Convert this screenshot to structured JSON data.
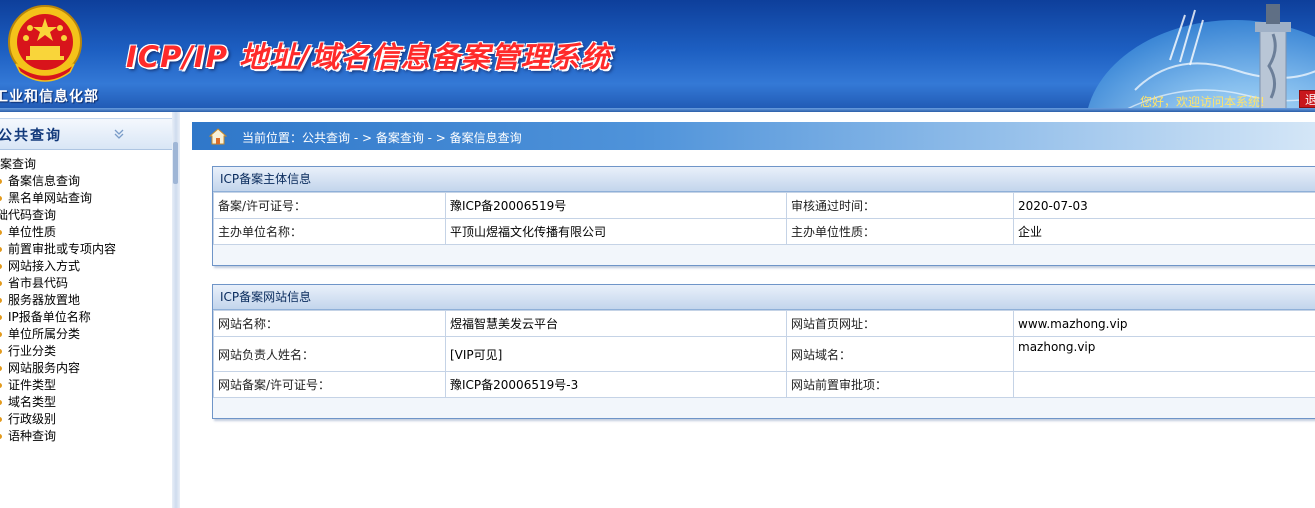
{
  "header": {
    "ministry": "工业和信息化部",
    "title": "ICP/IP 地址/域名信息备案管理系统",
    "welcome": "您好，欢迎访问本系统!",
    "logout": "退"
  },
  "sidebar": {
    "title": "公共查询",
    "groups": [
      {
        "label": "备案查询",
        "items": [
          "备案信息查询",
          "黑名单网站查询"
        ]
      },
      {
        "label": "基础代码查询",
        "items": [
          "单位性质",
          "前置审批或专项内容",
          "网站接入方式",
          "省市县代码",
          "服务器放置地",
          "IP报备单位名称",
          "单位所属分类",
          "行业分类",
          "网站服务内容",
          "证件类型",
          "域名类型",
          "行政级别",
          "语种查询"
        ]
      }
    ]
  },
  "breadcrumb": "当前位置：公共查询 - > 备案查询 - > 备案信息查询",
  "subject": {
    "heading": "ICP备案主体信息",
    "rows": [
      [
        "备案/许可证号：",
        "豫ICP备20006519号",
        "审核通过时间：",
        "2020-07-03"
      ],
      [
        "主办单位名称：",
        "平顶山煜福文化传播有限公司",
        "主办单位性质：",
        "企业"
      ]
    ]
  },
  "website": {
    "heading": "ICP备案网站信息",
    "rows": [
      [
        "网站名称：",
        "煜福智慧美发云平台",
        "网站首页网址：",
        "www.mazhong.vip"
      ],
      [
        "网站负责人姓名：",
        "[VIP可见]",
        "网站域名：",
        "mazhong.vip"
      ],
      [
        "网站备案/许可证号：",
        "豫ICP备20006519号-3",
        "网站前置审批项：",
        ""
      ]
    ]
  },
  "colors": {
    "header_blue": "#1d5fc2",
    "title_red": "#ff2a2a",
    "link_blue": "#1a5cc8",
    "bullet_orange": "#e39a1c"
  }
}
